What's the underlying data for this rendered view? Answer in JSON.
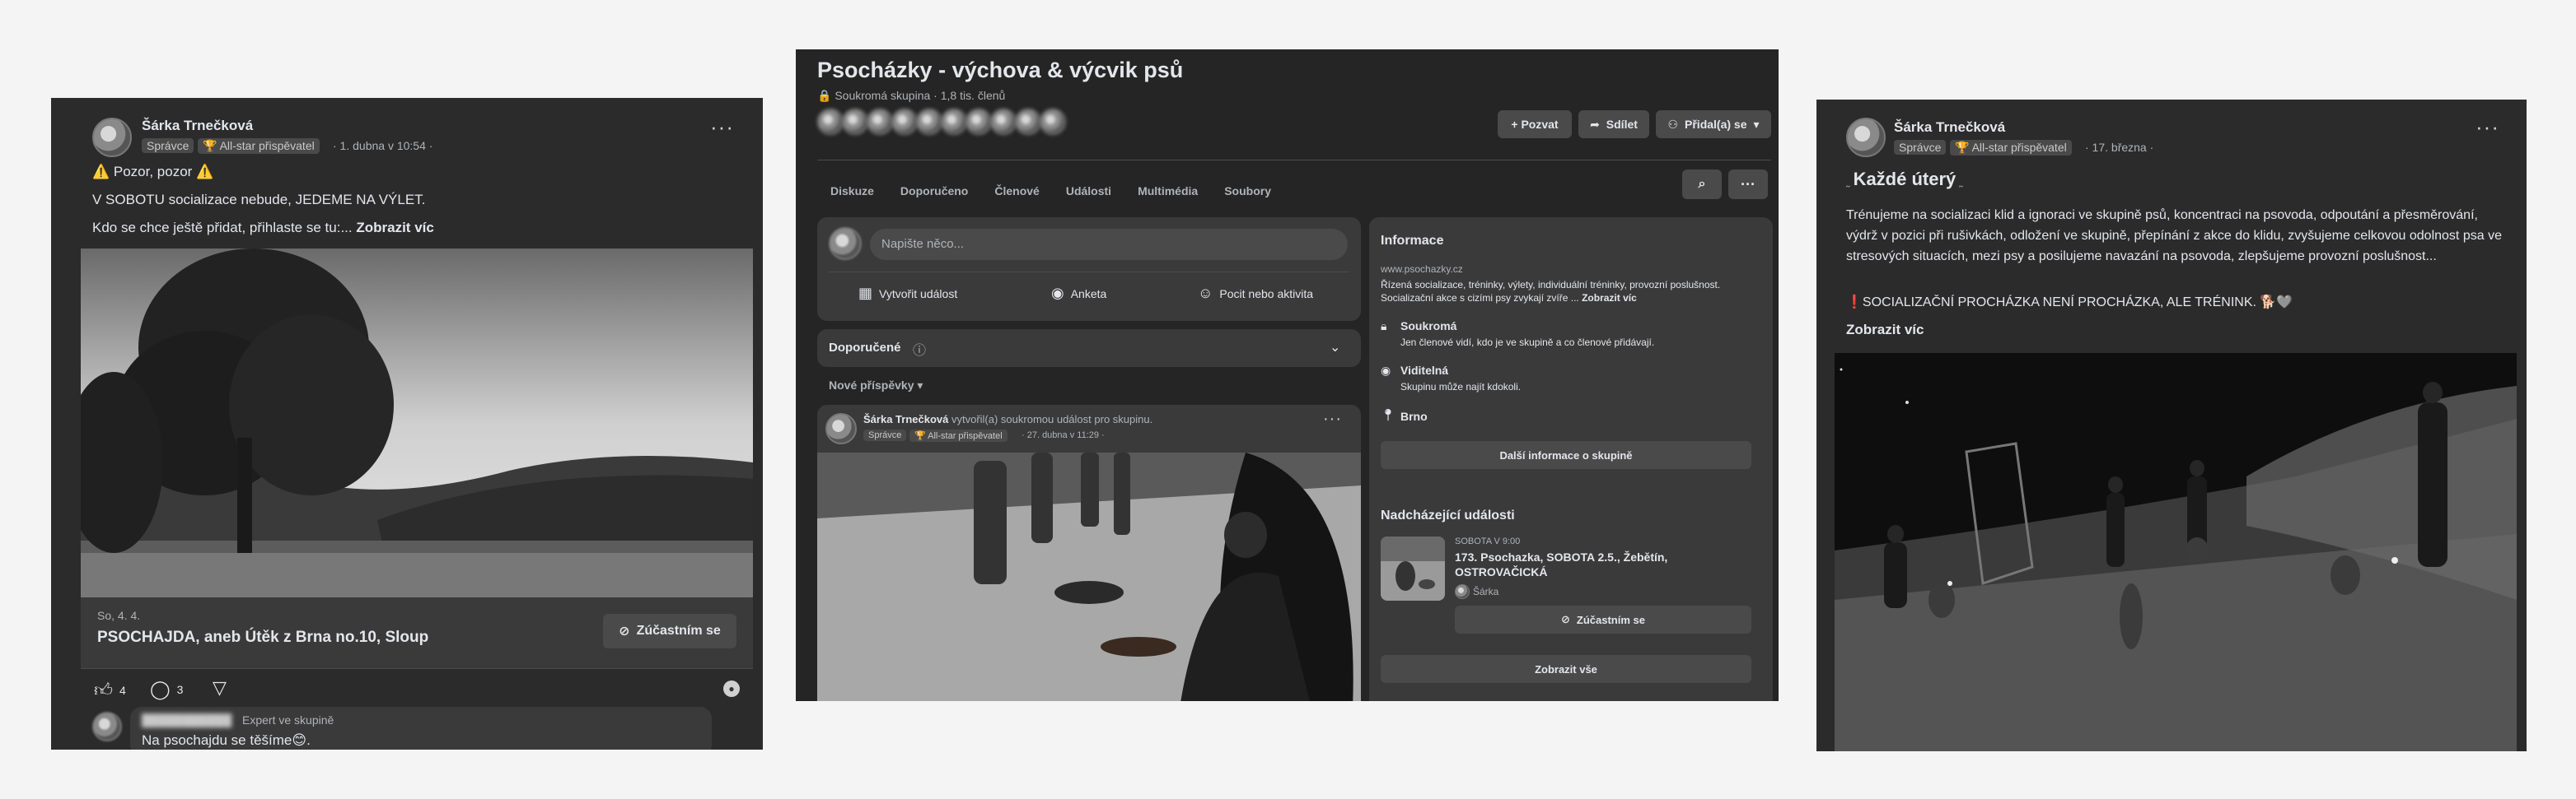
{
  "left": {
    "author": "Šárka Trnečková",
    "badge_admin": "Správce",
    "badge_allstar": "All-star přispěvatel",
    "timestamp": "· 1. dubna v 10:54 ·",
    "line1": "⚠️ Pozor, pozor ⚠️",
    "line2": "V SOBOTU socializace nebude, JEDEME NA VÝLET.",
    "line3": "Kdo se chce ještě přidat, přihlaste se tu:...",
    "see_more": "Zobrazit víc",
    "event_date": "So, 4. 4.",
    "event_title": "PSOCHAJDA, aneb Útěk z Brna no.10, Sloup",
    "event_button": "Zúčastním se",
    "likes": "4",
    "comments": "3",
    "comment_role": "Expert ve skupině",
    "comment_text": "Na psochajdu se těšíme😊."
  },
  "center": {
    "group_name": "Psocházky - výchova & výcvik psů",
    "group_meta": "🔒 Soukromá skupina · 1,8 tis. členů",
    "invite": "+ Pozvat",
    "share": "Sdílet",
    "joined": "Přidal(a) se",
    "tabs": [
      "Diskuze",
      "Doporučeno",
      "Členové",
      "Události",
      "Multimédia",
      "Soubory"
    ],
    "composer_placeholder": "Napište něco...",
    "create_event": "Vytvořit událost",
    "poll": "Anketa",
    "feeling": "Pocit nebo aktivita",
    "recommended": "Doporučené",
    "new_posts": "Nové příspěvky",
    "post_author": "Šárka Trnečková",
    "post_action": "vytvořil(a) soukromou událost pro skupinu.",
    "post_badge_admin": "Správce",
    "post_badge_allstar": "All-star přispěvatel",
    "post_time": "· 27. dubna v 11:29 ·",
    "info_title": "Informace",
    "info_url": "www.psochazky.cz",
    "info_desc": "Řízená socializace, tréninky, výlety, individuální tréninky, provozní poslušnost. Socializační akce s cizími psy zvykají zvíře ...",
    "info_more": "Zobrazit víc",
    "private_title": "Soukromá",
    "private_desc": "Jen členové vidí, kdo je ve skupině a co členové přidávají.",
    "visible_title": "Viditelná",
    "visible_desc": "Skupinu může najít kdokoli.",
    "location": "Brno",
    "more_info_btn": "Další informace o skupině",
    "upcoming_title": "Nadcházející události",
    "event_when": "SOBOTA V 9:00",
    "event_name": "173. Psochazka, SOBOTA 2.5., Žebětín, OSTROVAČICKÁ",
    "event_host": "Šárka",
    "event_btn": "Zúčastním se",
    "show_all": "Zobrazit vše"
  },
  "right": {
    "author": "Šárka Trnečková",
    "badge_admin": "Správce",
    "badge_allstar": "All-star přispěvatel",
    "timestamp": "· 17. března ·",
    "title": "Každé úterý",
    "body": "Trénujeme na socializaci klid a ignoraci ve skupině psů, koncentraci na psovoda, odpoutání a přesměrování, výdrž v pozici při rušivkách, odložení ve skupině, přepínání z akce do klidu, zvyšujeme celkovou odolnost psa ve stresových situacích, mezi psy a posilujeme navazání na psovoda, zlepšujeme provozní poslušnost...",
    "line2": "❗SOCIALIZAČNÍ PROCHÁZKA NENÍ PROCHÁZKA, ALE TRÉNINK. 🐕🩶",
    "see_more": "Zobrazit víc"
  }
}
